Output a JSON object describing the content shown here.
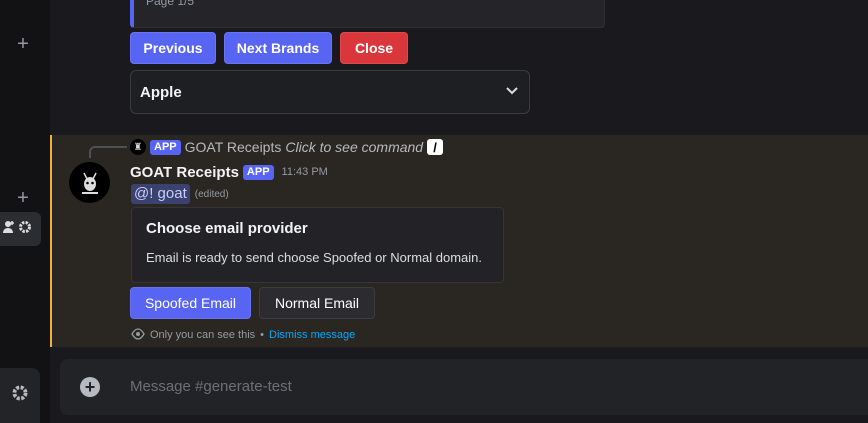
{
  "rail": {
    "plus_glyph": "+",
    "icons": [
      "add-member-icon",
      "gear-icon",
      "plus-icon"
    ]
  },
  "previous_message": {
    "page_indicator": "Page 1/5",
    "buttons": {
      "previous": "Previous",
      "next": "Next Brands",
      "close": "Close"
    },
    "select_value": "Apple"
  },
  "message": {
    "reply": {
      "app_tag": "APP",
      "bot_name": "GOAT Receipts",
      "command_hint": "Click to see command"
    },
    "author": "GOAT Receipts",
    "app_tag": "APP",
    "timestamp": "11:43 PM",
    "mention": "@! goat",
    "edited": "(edited)",
    "embed": {
      "title": "Choose email provider",
      "description": "Email is ready to send choose Spoofed or Normal domain."
    },
    "buttons": {
      "spoofed": "Spoofed Email",
      "normal": "Normal Email"
    },
    "ephemeral": {
      "notice": "Only you can see this",
      "separator": "•",
      "dismiss": "Dismiss message"
    }
  },
  "composer": {
    "placeholder": "Message #generate-test"
  },
  "colors": {
    "blurple": "#5865f2",
    "danger": "#da373c",
    "highlight": "#f0b232",
    "link": "#00a8fc"
  }
}
